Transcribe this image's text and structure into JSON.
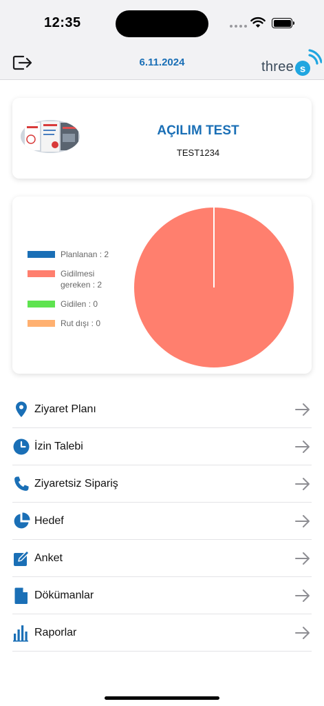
{
  "status_bar": {
    "time": "12:35"
  },
  "header": {
    "date": "6.11.2024",
    "brand": "three",
    "brand_mark": "s"
  },
  "profile": {
    "name": "AÇILIM TEST",
    "code": "TEST1234"
  },
  "chart_data": {
    "type": "pie",
    "legend_position": "left",
    "series": [
      {
        "name": "Planlanan",
        "value": 2,
        "label": "Planlanan : 2",
        "color": "#1a6fb6"
      },
      {
        "name": "Gidilmesi gereken",
        "value": 2,
        "label": "Gidilmesi gereken : 2",
        "color": "#ff7f6e"
      },
      {
        "name": "Gidilen",
        "value": 0,
        "label": "Gidilen : 0",
        "color": "#5ee34f"
      },
      {
        "name": "Rut dışı",
        "value": 0,
        "label": "Rut dışı : 0",
        "color": "#ffb070"
      }
    ],
    "pie_slices": [
      "Gidilmesi gereken"
    ]
  },
  "menu": [
    {
      "label": "Ziyaret Planı",
      "icon": "location-pin-icon"
    },
    {
      "label": "İzin Talebi",
      "icon": "clock-icon"
    },
    {
      "label": "Ziyaretsiz Sipariş",
      "icon": "phone-icon"
    },
    {
      "label": "Hedef",
      "icon": "pie-chart-icon"
    },
    {
      "label": "Anket",
      "icon": "edit-icon"
    },
    {
      "label": "Dökümanlar",
      "icon": "document-icon"
    },
    {
      "label": "Raporlar",
      "icon": "bar-chart-icon"
    }
  ],
  "colors": {
    "accent": "#1a6fb6",
    "pie_fill": "#ff7f6e"
  }
}
